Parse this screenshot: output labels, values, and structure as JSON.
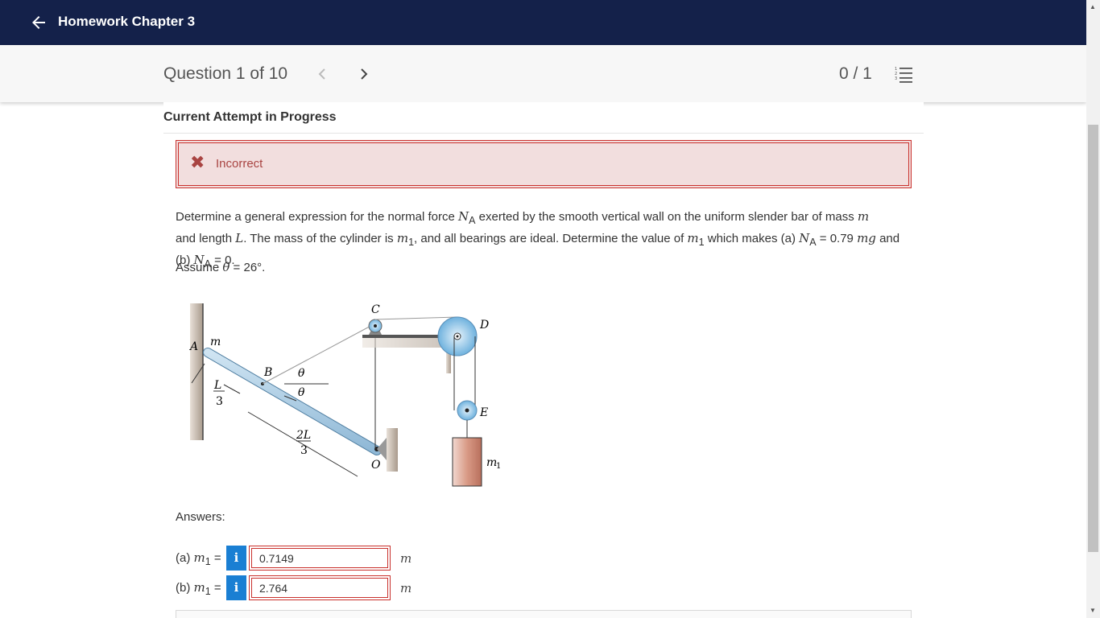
{
  "header": {
    "title": "Homework Chapter 3"
  },
  "question_nav": {
    "label": "Question 1 of 10",
    "score": "0 / 1"
  },
  "attempt": {
    "title": "Current Attempt in Progress"
  },
  "alert": {
    "text": "Incorrect",
    "icon": "close-x-icon",
    "color": "#a94442"
  },
  "question": {
    "line1_a": "Determine a general expression for the normal force ",
    "N": "N",
    "A_sub": "A",
    "line1_b": " exerted by the smooth vertical wall on the uniform slender bar of mass ",
    "m": "m",
    "line2_a": " and length ",
    "L": "L",
    "line2_b": ". The mass of the cylinder is ",
    "m1": "m",
    "one_sub": "1",
    "line2_c": ", and all bearings are ideal. Determine the value of ",
    "line2_d": " which makes (a) ",
    "eq_a": " = 0.79 ",
    "mg": "mg",
    "line2_e": " and",
    "line3_a": "(b) ",
    "eq_b": " = 0.",
    "assume_prefix": "Assume ",
    "theta": "θ",
    "assume_rest": " = 26°."
  },
  "figure": {
    "labels": {
      "C": "C",
      "D": "D",
      "A": "A",
      "m": "m",
      "B": "B",
      "theta": "θ",
      "L": "L",
      "three": "3",
      "twoL": "2L",
      "E": "E",
      "O": "O",
      "m1": "m",
      "one": "1"
    }
  },
  "answers": {
    "label": "Answers:",
    "rows": [
      {
        "prefix": "(a) ",
        "var": "m",
        "sub": "1",
        "suffix": " =",
        "value": "0.7149",
        "unit": "m"
      },
      {
        "prefix": "(b) ",
        "var": "m",
        "sub": "1",
        "suffix": " =",
        "value": "2.764",
        "unit": "m"
      }
    ],
    "info_icon": "i"
  },
  "colors": {
    "header_bg": "#14214a",
    "info_button": "#1a7fd3",
    "error_border": "#c9302c"
  }
}
